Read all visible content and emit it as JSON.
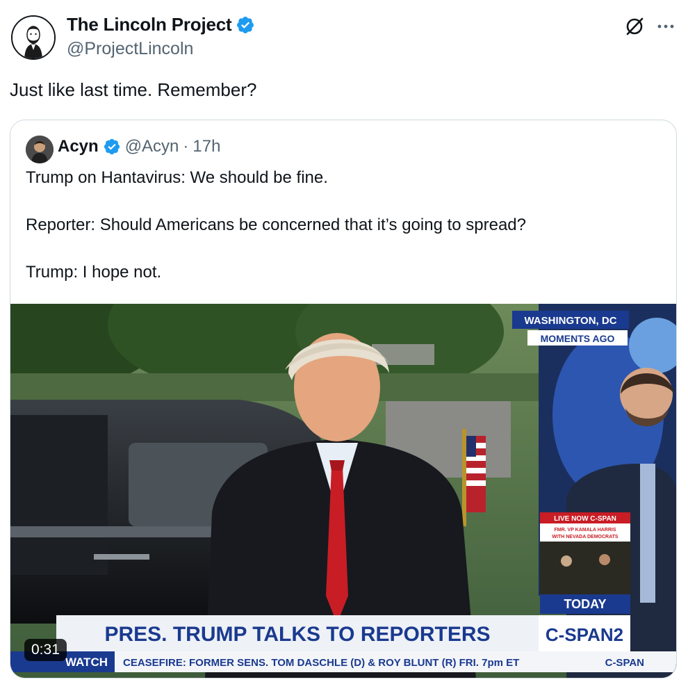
{
  "author": {
    "display_name": "The Lincoln Project",
    "handle": "@ProjectLincoln",
    "verified": true
  },
  "post": {
    "text": "Just like last time. Remember?"
  },
  "quote": {
    "display_name": "Acyn",
    "handle": "@Acyn",
    "separator": "·",
    "time": "17h",
    "lines": [
      "Trump on Hantavirus: We should be fine.",
      "Reporter: Should Americans be concerned that it’s going to spread?",
      "Trump: I hope not."
    ]
  },
  "video": {
    "duration": "0:31",
    "location_tag": "WASHINGTON, DC",
    "time_tag": "MOMENTS AGO",
    "headline": "PRES. TRUMP TALKS TO REPORTERS",
    "network_logo": "C-SPAN2",
    "ticker_label": "WATCH",
    "ticker_text": "CEASEFIRE: FORMER SENS. TOM DASCHLE (D) & ROY BLUNT (R)   FRI. 7pm ET",
    "ticker_logo": "C-SPAN",
    "live_label": "LIVE NOW C-SPAN",
    "live_sub1": "FMR. VP KAMALA HARRIS",
    "live_sub2": "WITH NEVADA DEMOCRATS",
    "today_label": "TODAY"
  },
  "icons": {
    "verified": "verified-badge-icon",
    "grok": "grok-icon",
    "more": "more-icon"
  },
  "colors": {
    "verified_blue": "#1d9bf0",
    "text_primary": "#0f1419",
    "text_secondary": "#536471",
    "border": "#cfd9de",
    "cspan_blue": "#1a3a8f",
    "tie_red": "#c81d25"
  }
}
